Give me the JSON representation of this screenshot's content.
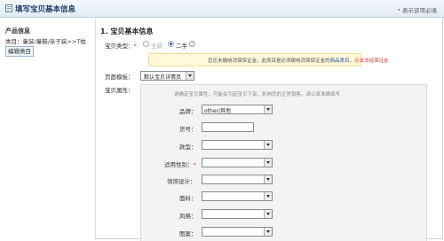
{
  "header": {
    "title": "填写宝贝基本信息",
    "required_note": "表示该项必填",
    "required_star": "*"
  },
  "sidebar": {
    "heading": "产品信息",
    "category_path": "类目：童装/童鞋/亲子装>>T恤",
    "edit_button": "编辑类目"
  },
  "form": {
    "section_title": "1. 宝贝基本信息",
    "item_type": {
      "label": "宝贝类型：",
      "star": "*",
      "options": [
        "全新",
        "二手"
      ],
      "selected": "二手"
    },
    "notice": {
      "text": "您还未缴纳消保保证金，此类目是必须缴纳消保保证金的",
      "link_text": "商品类目",
      "sep": "，",
      "action_text": "点击冻结保证金"
    },
    "template": {
      "label": "页面模板：",
      "value": "默认宝贝详情页"
    },
    "attrs_label": "宝贝属性：",
    "attr_hint": "请确定宝贝属性，可能会引起宝贝下架，影响您的正常销售，请认真准确填写",
    "attributes": [
      {
        "label": "品牌：",
        "value": "other/其他",
        "type": "select",
        "required": false
      },
      {
        "label": "货号：",
        "value": "",
        "type": "text",
        "required": false
      },
      {
        "label": "款型：",
        "value": "",
        "type": "select",
        "required": false
      },
      {
        "label": "适用性别：",
        "value": "",
        "type": "select",
        "required": true
      },
      {
        "label": "领饰设计：",
        "value": "",
        "type": "select",
        "required": false
      },
      {
        "label": "面料：",
        "value": "",
        "type": "select",
        "required": false
      },
      {
        "label": "风格：",
        "value": "",
        "type": "select",
        "required": false
      },
      {
        "label": "图案：",
        "value": "",
        "type": "select",
        "required": false
      }
    ]
  },
  "colors": {
    "accent": "#1e4fa3",
    "required": "#e4393c",
    "notice_bg": "#fff9d9",
    "panel_bg": "#f3f3f3"
  }
}
